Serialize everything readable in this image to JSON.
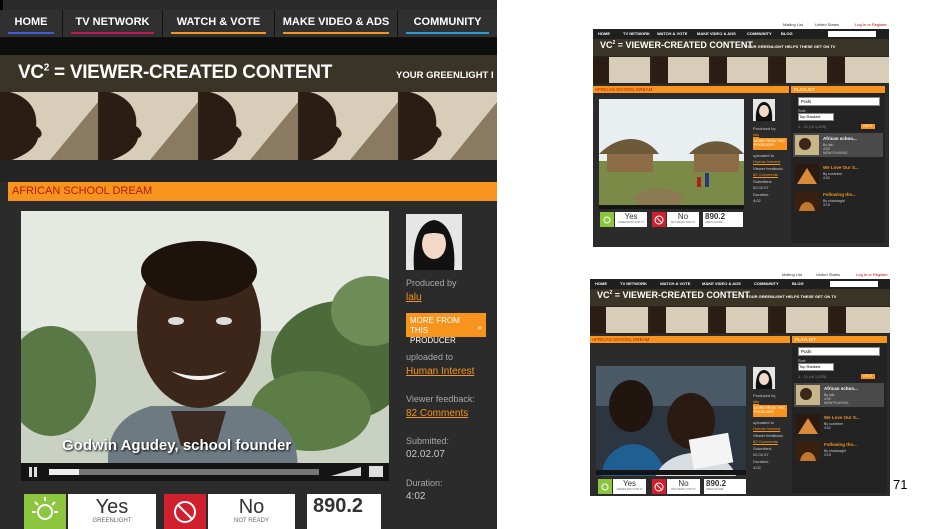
{
  "nav": {
    "tabs": [
      {
        "label": "HOME",
        "accent": "#3b5bdb"
      },
      {
        "label": "TV NETWORK",
        "accent": "#c2185b"
      },
      {
        "label": "WATCH & VOTE",
        "accent": "#f7941d"
      },
      {
        "label": "MAKE VIDEO & ADS",
        "accent": "#f7941d"
      },
      {
        "label": "COMMUNITY",
        "accent": "#2e9bd6"
      },
      {
        "label": "BLOG",
        "accent": "#8cc63f"
      }
    ]
  },
  "header": {
    "vc_prefix": "VC",
    "vc_sup": "2",
    "vc_text": " = VIEWER-CREATED CONTENT",
    "tagline": "YOUR GREENLIGHT HELPS THESE GET ON TV",
    "tagline_truncated": "YOUR GREENLIGHT I",
    "top_mailing": "Mailing List",
    "top_country": "United States",
    "top_login": "Log In or Register"
  },
  "video": {
    "title": "AFRICAN SCHOOL DREAM",
    "caption": "Godwin Agudey, school founder",
    "produced_by_label": "Produced by",
    "producer": "lalu",
    "more_button": "MORE FROM THIS PRODUCER",
    "uploaded_to_label": "uploaded to",
    "uploaded_to": "Human Interest",
    "feedback_label": "Viewer feedback:",
    "feedback": "82 Comments",
    "submitted_label": "Submitted:",
    "submitted": "02.02.07",
    "duration_label": "Duration:",
    "duration": "4:02"
  },
  "vote": {
    "yes_label": "Yes",
    "yes_sub": "GREENLIGHT",
    "yes_sub_small": "GREENLIGHT FOR TV",
    "no_label": "No",
    "no_sub": "NOT READY",
    "no_sub_small": "NOT READY FOR TV",
    "score": "890.2",
    "score_label": "VIDEO SCORE"
  },
  "playlist": {
    "title": "PLAYLIST",
    "select_value": "Pods",
    "sort_label": "Sort:",
    "sort_value": "Top Ranked",
    "range": "1 - 11 (of 1,029)",
    "next": "NEXT",
    "items": [
      {
        "title": "African schoo...",
        "meta1": "By lalu",
        "meta2": "4:02",
        "meta3": "NOW PLAYING",
        "color": "#ffffff"
      },
      {
        "title": "We Love Our S...",
        "meta1": "By sunshine",
        "meta2": "4:02",
        "meta3": "",
        "color": "#f7941d"
      },
      {
        "title": "Following the...",
        "meta1": "By shadowgirl",
        "meta2": "3:15",
        "meta3": "",
        "color": "#f7941d"
      }
    ]
  },
  "page_number": "71"
}
